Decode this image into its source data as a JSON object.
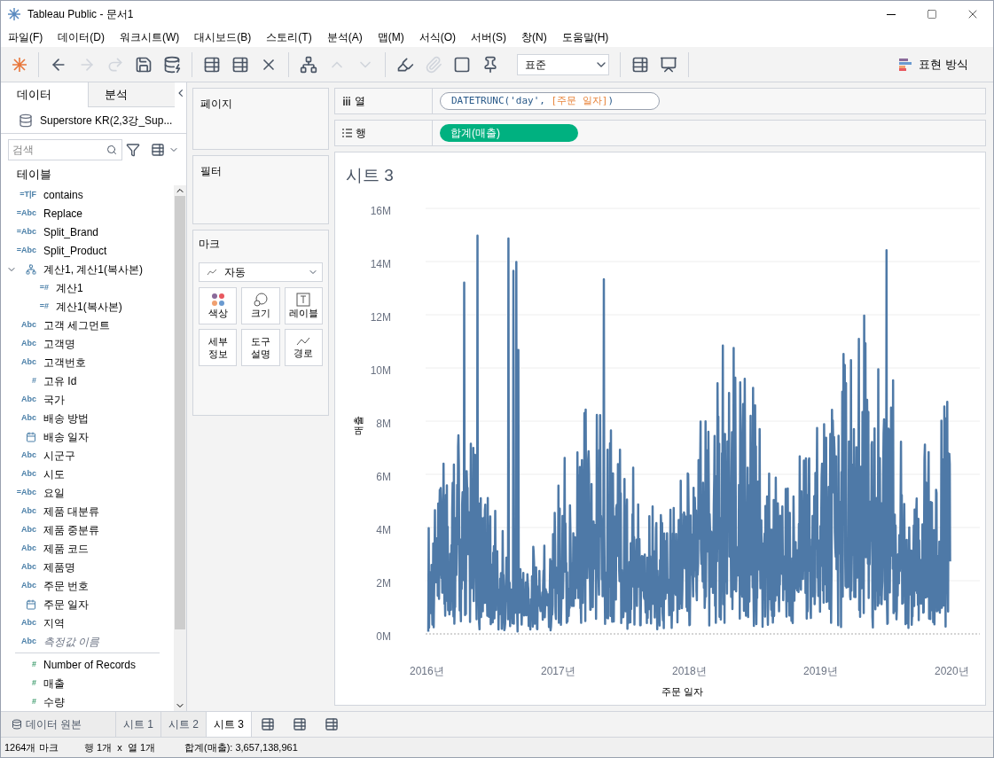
{
  "window": {
    "title": "Tableau Public - 문서1"
  },
  "menu": [
    "파일(F)",
    "데이터(D)",
    "워크시트(W)",
    "대시보드(B)",
    "스토리(T)",
    "분석(A)",
    "맵(M)",
    "서식(O)",
    "서버(S)",
    "창(N)",
    "도움말(H)"
  ],
  "toolbar": {
    "fit": "표준",
    "show_me": "표현 방식"
  },
  "data_pane": {
    "tabs": [
      {
        "label": "데이터",
        "selected": true
      },
      {
        "label": "분석",
        "selected": false
      }
    ],
    "source": "Superstore KR(2,3강_Sup...",
    "search": {
      "placeholder": "검색"
    },
    "section": "테이블",
    "fields": [
      {
        "name": "contains",
        "icon": "=T|F",
        "kind": "dimension"
      },
      {
        "name": "Replace",
        "icon": "=Abc",
        "kind": "dimension"
      },
      {
        "name": "Split_Brand",
        "icon": "=Abc",
        "kind": "dimension"
      },
      {
        "name": "Split_Product",
        "icon": "=Abc",
        "kind": "dimension"
      },
      {
        "name": "계산1, 계산1(복사본)",
        "kind": "hierarchy",
        "expanded": true,
        "children": [
          {
            "name": "계산1",
            "icon": "=#",
            "kind": "dimension"
          },
          {
            "name": "계산1(복사본)",
            "icon": "=#",
            "kind": "dimension"
          }
        ]
      },
      {
        "name": "고객 세그먼트",
        "icon": "Abc",
        "kind": "dimension"
      },
      {
        "name": "고객명",
        "icon": "Abc",
        "kind": "dimension"
      },
      {
        "name": "고객번호",
        "icon": "Abc",
        "kind": "dimension"
      },
      {
        "name": "고유 Id",
        "icon": "#",
        "kind": "dimension"
      },
      {
        "name": "국가",
        "icon": "Abc",
        "kind": "dimension"
      },
      {
        "name": "배송 방법",
        "icon": "Abc",
        "kind": "dimension"
      },
      {
        "name": "배송 일자",
        "kind": "date"
      },
      {
        "name": "시군구",
        "icon": "Abc",
        "kind": "dimension"
      },
      {
        "name": "시도",
        "icon": "Abc",
        "kind": "dimension"
      },
      {
        "name": "요일",
        "icon": "=Abc",
        "kind": "dimension"
      },
      {
        "name": "제품 대분류",
        "icon": "Abc",
        "kind": "dimension"
      },
      {
        "name": "제품 중분류",
        "icon": "Abc",
        "kind": "dimension"
      },
      {
        "name": "제품 코드",
        "icon": "Abc",
        "kind": "dimension"
      },
      {
        "name": "제품명",
        "icon": "Abc",
        "kind": "dimension"
      },
      {
        "name": "주문 번호",
        "icon": "Abc",
        "kind": "dimension"
      },
      {
        "name": "주문 일자",
        "kind": "date"
      },
      {
        "name": "지역",
        "icon": "Abc",
        "kind": "dimension"
      },
      {
        "name": "측정값 이름",
        "icon": "Abc",
        "kind": "measure-names"
      }
    ],
    "measures": [
      {
        "name": "Number of Records",
        "icon": "#"
      },
      {
        "name": "매출",
        "icon": "#"
      },
      {
        "name": "수량",
        "icon": "#"
      }
    ]
  },
  "pages": "페이지",
  "filters": "필터",
  "marks": {
    "title": "마크",
    "type": "자동",
    "cards": [
      {
        "label": "색상",
        "kind": "color"
      },
      {
        "label": "크기",
        "kind": "size"
      },
      {
        "label": "레이블",
        "kind": "label"
      },
      {
        "label": "세부\n정보",
        "kind": "detail"
      },
      {
        "label": "도구\n설명",
        "kind": "tooltip"
      },
      {
        "label": "경로",
        "kind": "path"
      }
    ]
  },
  "columns_shelf": {
    "label": "열",
    "parts": [
      {
        "text": "DATETRUNC('day', ",
        "kind": "function"
      },
      {
        "text": "[주문 일자]",
        "kind": "field"
      },
      {
        "text": ")",
        "kind": "function"
      }
    ]
  },
  "rows_shelf": {
    "label": "행",
    "pill": "합계(매출)"
  },
  "view": {
    "title": "시트 3",
    "y_title": "매출",
    "x_title": "주문 일자",
    "y_ticks": [
      "16M",
      "14M",
      "12M",
      "10M",
      "8M",
      "6M",
      "4M",
      "2M",
      "0M"
    ],
    "x_ticks": [
      "2016년",
      "2017년",
      "2018년",
      "2019년",
      "2020년"
    ]
  },
  "sheet_tabs": [
    {
      "label": "데이터 원본",
      "kind": "datasource",
      "selected": false
    },
    {
      "label": "시트 1",
      "kind": "sheet",
      "selected": false
    },
    {
      "label": "시트 2",
      "kind": "sheet",
      "selected": false
    },
    {
      "label": "시트 3",
      "kind": "sheet",
      "selected": true
    }
  ],
  "status": [
    "1264개 마크",
    "행 1개  x  열 1개",
    "합계(매출): 3,657,138,961"
  ]
}
